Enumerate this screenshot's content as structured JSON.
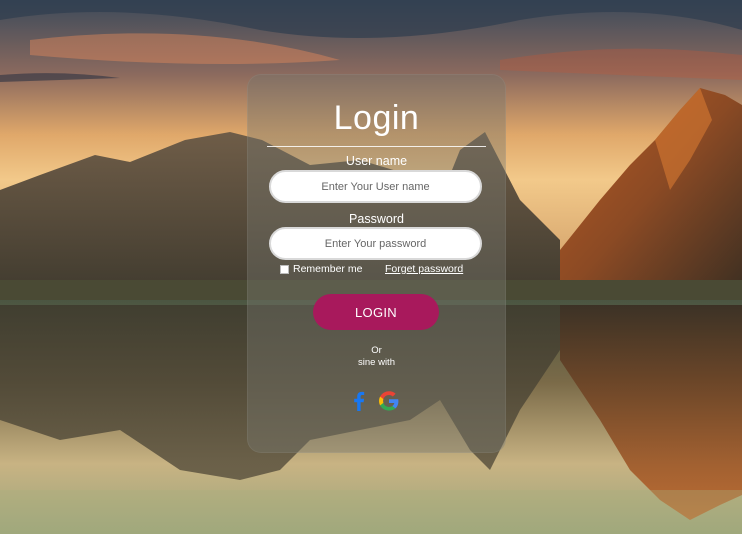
{
  "login_form": {
    "title": "Login",
    "username_label": "User name",
    "username_placeholder": "Enter Your User name",
    "username_value": "",
    "password_label": "Password",
    "password_placeholder": "Enter Your password",
    "password_value": "",
    "remember_label": "Remember me",
    "remember_checked": false,
    "forget_label": "Forget password",
    "submit_label": "LOGIN",
    "or_text": "Or",
    "sine_text": "sine with"
  },
  "social": [
    {
      "icon": "facebook-icon",
      "color": "#1877f2"
    },
    {
      "icon": "google-icon",
      "color": "#34a853"
    }
  ],
  "colors": {
    "login_button": "#a8195c",
    "card_overlay": "rgba(120,118,110,0.42)"
  }
}
